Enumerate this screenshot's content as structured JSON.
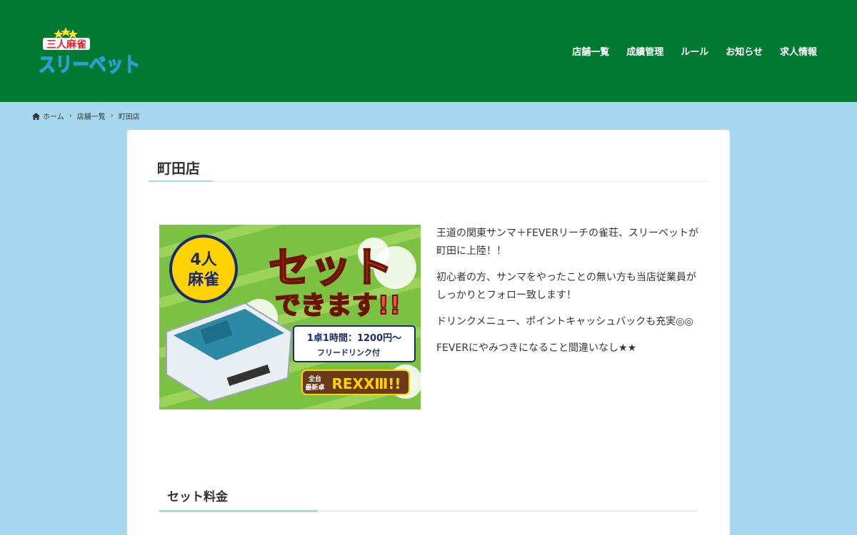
{
  "header": {
    "logo_text_top": "三人麻雀",
    "logo_text_main": "スリーベット",
    "nav": [
      {
        "label": "店舗一覧"
      },
      {
        "label": "成績管理"
      },
      {
        "label": "ルール"
      },
      {
        "label": "お知らせ"
      },
      {
        "label": "求人情報"
      }
    ],
    "color": "#007a33"
  },
  "breadcrumb": {
    "home": "ホーム",
    "level1": "店舗一覧",
    "current": "町田店"
  },
  "page": {
    "title": "町田店",
    "background": "#a6d8ef"
  },
  "banner": {
    "badge_line1": "4人",
    "badge_line2": "麻雀",
    "headline1": "セット",
    "headline2": "できます!!",
    "price_line": "1卓1時間：1200円〜",
    "drink_line": "フリードリンク付",
    "table_tag1": "全台",
    "table_tag2": "最新卓",
    "table_model": "REXXⅢ!!"
  },
  "description": [
    "王道の関東サンマ＋FEVERリーチの雀荘、スリーベットが町田に上陸！！",
    "初心者の方、サンマをやったことの無い方も当店従業員がしっかりとフォロー致します！",
    "ドリンクメニュー、ポイントキャッシュバックも充実◎◎",
    "FEVERにやみつきになること間違いなし★★"
  ],
  "section": {
    "title": "セット料金"
  }
}
